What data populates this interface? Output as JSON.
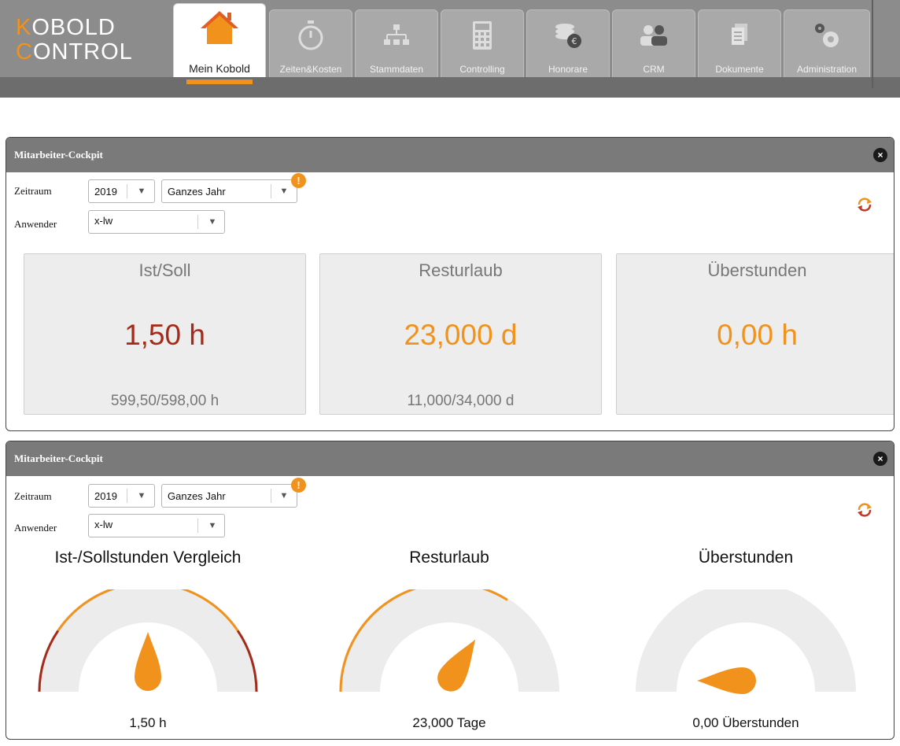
{
  "app": {
    "logo_line1_initial": "K",
    "logo_line1_rest": "OBOLD",
    "logo_line2_initial": "C",
    "logo_line2_rest": "ONTROL",
    "accent_color": "#f0921c"
  },
  "nav": {
    "tabs": [
      {
        "label": "Mein Kobold",
        "icon": "home-icon",
        "active": true
      },
      {
        "label": "Zeiten&Kosten",
        "icon": "stopwatch-icon",
        "active": false
      },
      {
        "label": "Stammdaten",
        "icon": "hierarchy-icon",
        "active": false
      },
      {
        "label": "Controlling",
        "icon": "calculator-icon",
        "active": false
      },
      {
        "label": "Honorare",
        "icon": "coins-euro-icon",
        "active": false
      },
      {
        "label": "CRM",
        "icon": "contacts-icon",
        "active": false
      },
      {
        "label": "Dokumente",
        "icon": "documents-icon",
        "active": false
      },
      {
        "label": "Administration",
        "icon": "gears-icon",
        "active": false
      }
    ]
  },
  "panels": [
    {
      "title": "Mitarbeiter-Cockpit",
      "close": "×",
      "zeitraum_label": "Zeitraum",
      "year": "2019",
      "period": "Ganzes Jahr",
      "warn": "!",
      "anwender_label": "Anwender",
      "anwender": "x-lw",
      "cards": [
        {
          "title": "Ist/Soll",
          "value": "1,50 h",
          "sub": "599,50/598,00 h",
          "color": "#a52a1a"
        },
        {
          "title": "Resturlaub",
          "value": "23,000 d",
          "sub": "11,000/34,000 d",
          "color": "#f0921c"
        },
        {
          "title": "Überstunden",
          "value": "0,00 h",
          "sub": "",
          "color": "#f0921c"
        }
      ]
    },
    {
      "title": "Mitarbeiter-Cockpit",
      "close": "×",
      "zeitraum_label": "Zeitraum",
      "year": "2019",
      "period": "Ganzes Jahr",
      "warn": "!",
      "anwender_label": "Anwender",
      "anwender": "x-lw",
      "gauges": [
        {
          "title": "Ist-/Sollstunden Vergleich",
          "value_label": "1,50 h",
          "needle_fraction": 0.5,
          "band_fraction": 1.0,
          "style": "ist-soll"
        },
        {
          "title": "Resturlaub",
          "value_label": "23,000 Tage",
          "needle_fraction": 0.68,
          "band_fraction": 0.68,
          "style": "single"
        },
        {
          "title": "Überstunden",
          "value_label": "0,00 Überstunden",
          "needle_fraction": 0.0,
          "band_fraction": 0.0,
          "style": "single"
        }
      ]
    }
  ],
  "colors": {
    "orange": "#f0921c",
    "dark_red": "#a52a1a",
    "gauge_track": "#ececec"
  }
}
